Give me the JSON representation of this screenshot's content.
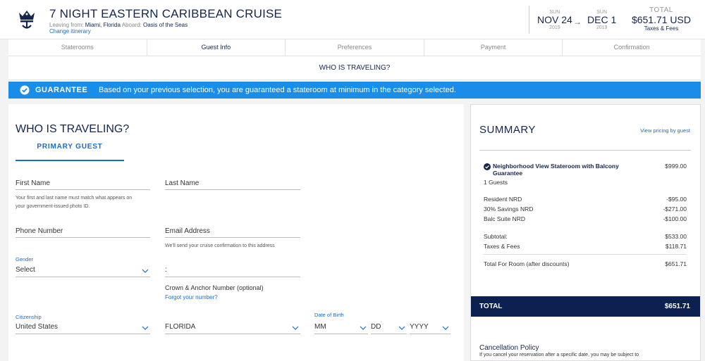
{
  "header": {
    "title": "7 NIGHT EASTERN CARIBBEAN CRUISE",
    "leaving_label": "Leaving from:",
    "leaving_value": "Miami, Florida",
    "aboard_label": "Aboard:",
    "aboard_value": "Oasis of the Seas",
    "change_itinerary": "Change itinerary",
    "start": {
      "dow": "SUN",
      "date": "NOV 24",
      "year": "2019"
    },
    "end": {
      "dow": "SUN",
      "date": "DEC 1",
      "year": "2019"
    },
    "total_label": "TOTAL",
    "total_value": "$651.71 USD",
    "total_note": "Taxes & Fees"
  },
  "steps": [
    "Staterooms",
    "Guest Info",
    "Preferences",
    "Payment",
    "Confirmation"
  ],
  "active_step": "Guest Info",
  "traveling_bar": "WHO IS TRAVELING?",
  "guarantee": {
    "label": "GUARANTEE",
    "text": "Based on your previous selection, you are guaranteed a stateroom at minimum in the category selected."
  },
  "form": {
    "title": "WHO IS TRAVELING?",
    "tab": "PRIMARY GUEST",
    "first_name": "First Name",
    "last_name": "Last Name",
    "name_hint_1": "Your first and last name must match what appears on",
    "name_hint_2": "your government-issued photo ID.",
    "phone": "Phone Number",
    "email": "Email Address",
    "email_hint": "We'll send your cruise confirmation to this address",
    "gender_label": "Gender",
    "gender_value": "Select",
    "blank_field_value": ":",
    "crown_anchor": "Crown & Anchor Number (optional)",
    "forgot": "Forgot your number?",
    "citizenship_label": "Citizenship",
    "citizenship_value": "United States",
    "state_value": "FLORIDA",
    "dob_label": "Date of Birth",
    "dob_month": "MM",
    "dob_day": "DD",
    "dob_year": "YYYY"
  },
  "summary": {
    "title": "SUMMARY",
    "pricing_link": "View pricing by guest",
    "room_name_1": "Neighborhood View Stateroom with Balcony",
    "room_name_2": "Guarantee",
    "room_price": "$999.00",
    "guests": "1 Guests",
    "discounts": [
      {
        "label": "Resident NRD",
        "amount": "-$95.00"
      },
      {
        "label": "30% Savings NRD",
        "amount": "-$271.00"
      },
      {
        "label": "Balc Suite NRD",
        "amount": "-$100.00"
      }
    ],
    "subtotal_label": "Subtotal:",
    "subtotal": "$533.00",
    "taxes_label": "Taxes & Fees",
    "taxes": "$118.71",
    "room_total_label": "Total For Room (after discounts)",
    "room_total": "$651.71",
    "total_label": "TOTAL",
    "total": "$651.71",
    "cancel_title": "Cancellation Policy",
    "cancel_text": "If you cancel your reservation after a specific date, you may be subject to"
  },
  "colors": {
    "navy": "#15264c",
    "accent_blue": "#1a8de8",
    "link_blue": "#1a6ec7",
    "total_bar": "#0d2151"
  }
}
